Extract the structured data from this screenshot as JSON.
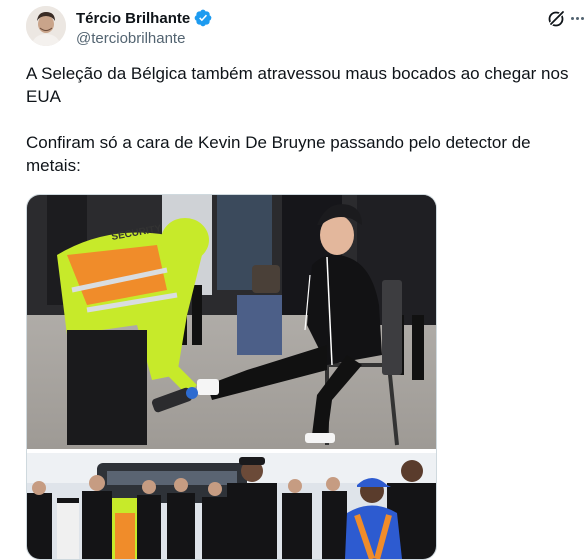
{
  "author": {
    "display_name": "Tércio Brilhante",
    "handle": "@terciobrilhante",
    "verified": true,
    "verified_color": "#1d9bf0",
    "avatar_icon": "person-avatar"
  },
  "header_icons": {
    "grok": "grok-icon",
    "more": "more-icon"
  },
  "tweet": {
    "paragraph_1": "A Seleção da Bélgica também atravessou maus bocados ao chegar nos EUA",
    "paragraph_2": "Confiram só a cara de Kevin De Bruyne passando pelo detector de metais:"
  },
  "media": {
    "count": 2,
    "photo_1": "player-metal-detector-photo",
    "photo_2": "team-arrival-photo"
  }
}
